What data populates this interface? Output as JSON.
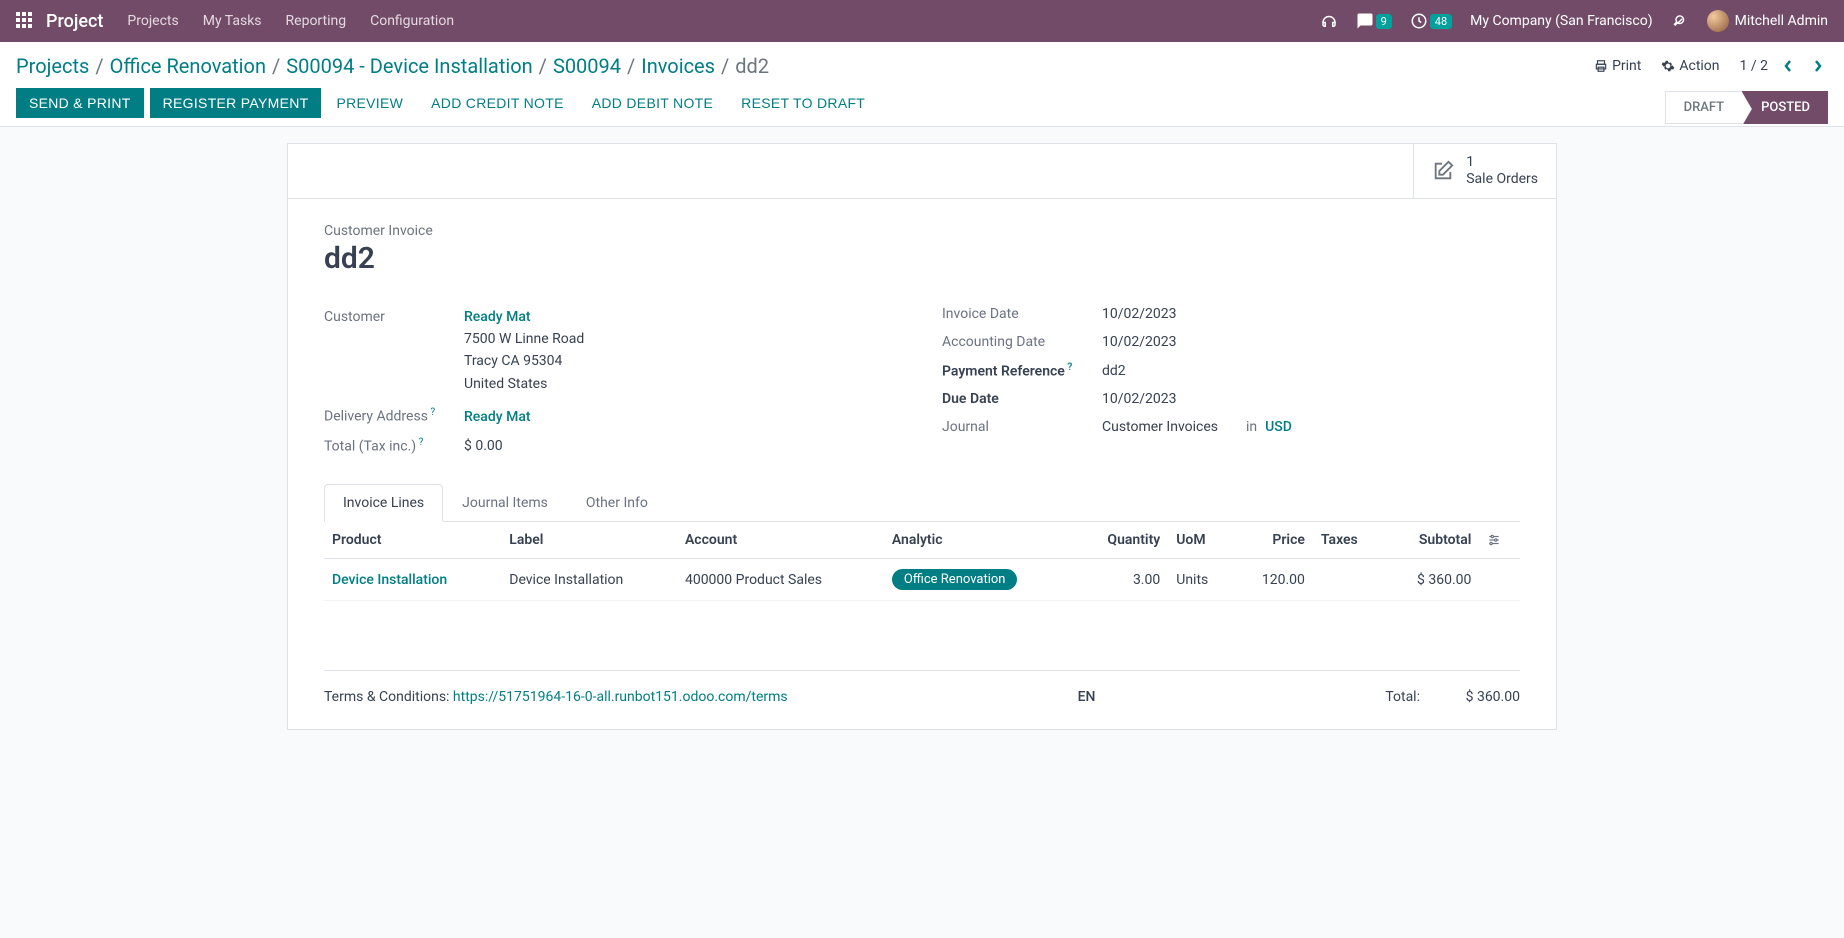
{
  "navbar": {
    "app_name": "Project",
    "menu": [
      "Projects",
      "My Tasks",
      "Reporting",
      "Configuration"
    ],
    "messages_badge": "9",
    "activities_badge": "48",
    "company": "My Company (San Francisco)",
    "user": "Mitchell Admin"
  },
  "breadcrumb": {
    "items": [
      "Projects",
      "Office Renovation",
      "S00094 - Device Installation",
      "S00094",
      "Invoices"
    ],
    "current": "dd2"
  },
  "cp": {
    "print": "Print",
    "action": "Action",
    "pager": "1 / 2"
  },
  "buttons": {
    "send_print": "SEND & PRINT",
    "register_payment": "REGISTER PAYMENT",
    "preview": "PREVIEW",
    "credit_note": "ADD CREDIT NOTE",
    "debit_note": "ADD DEBIT NOTE",
    "reset_draft": "RESET TO DRAFT"
  },
  "status": {
    "draft": "DRAFT",
    "posted": "POSTED"
  },
  "stat_button": {
    "count": "1",
    "label": "Sale Orders"
  },
  "record": {
    "type_label": "Customer Invoice",
    "name": "dd2",
    "customer_label": "Customer",
    "customer_name": "Ready Mat",
    "customer_addr1": "7500 W Linne Road",
    "customer_addr2": "Tracy CA 95304",
    "customer_addr3": "United States",
    "delivery_label": "Delivery Address",
    "delivery_value": "Ready Mat",
    "total_inc_label": "Total (Tax inc.)",
    "total_inc_value": "$ 0.00",
    "invoice_date_label": "Invoice Date",
    "invoice_date": "10/02/2023",
    "accounting_date_label": "Accounting Date",
    "accounting_date": "10/02/2023",
    "payment_ref_label": "Payment Reference",
    "payment_ref": "dd2",
    "due_date_label": "Due Date",
    "due_date": "10/02/2023",
    "journal_label": "Journal",
    "journal": "Customer Invoices",
    "journal_in": "in",
    "currency": "USD"
  },
  "tabs": {
    "lines": "Invoice Lines",
    "journal": "Journal Items",
    "other": "Other Info"
  },
  "table": {
    "headers": {
      "product": "Product",
      "label": "Label",
      "account": "Account",
      "analytic": "Analytic",
      "quantity": "Quantity",
      "uom": "UoM",
      "price": "Price",
      "taxes": "Taxes",
      "subtotal": "Subtotal"
    },
    "row": {
      "product": "Device Installation",
      "label": "Device Installation",
      "account": "400000 Product Sales",
      "analytic": "Office Renovation",
      "quantity": "3.00",
      "uom": "Units",
      "price": "120.00",
      "taxes": "",
      "subtotal": "$ 360.00"
    }
  },
  "footer": {
    "terms_prefix": "Terms & Conditions: ",
    "terms_link": "https://51751964-16-0-all.runbot151.odoo.com/terms",
    "lang": "EN",
    "total_label": "Total:",
    "total_value": "$ 360.00"
  }
}
